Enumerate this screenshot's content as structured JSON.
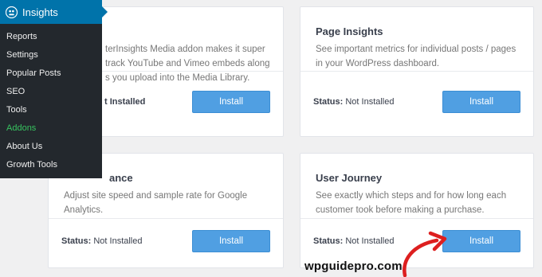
{
  "menu": {
    "title": "Insights",
    "items": [
      {
        "label": "Reports",
        "active": false
      },
      {
        "label": "Settings",
        "active": false
      },
      {
        "label": "Popular Posts",
        "active": false
      },
      {
        "label": "SEO",
        "active": false
      },
      {
        "label": "Tools",
        "active": false
      },
      {
        "label": "Addons",
        "active": true
      },
      {
        "label": "About Us",
        "active": false
      },
      {
        "label": "Growth Tools",
        "active": false
      }
    ]
  },
  "cards": [
    {
      "title": "",
      "description": "terInsights Media addon makes it super track YouTube and Vimeo embeds along s you upload into the Media Library.",
      "desc_lines": [
        "terInsights Media addon makes it super",
        "track YouTube and Vimeo embeds along",
        "s you upload into the Media Library."
      ],
      "status_prefix": "",
      "status_value": "t Installed",
      "button": "Install"
    },
    {
      "title": "Page Insights",
      "description": "See important metrics for individual posts / pages in your WordPress dashboard.",
      "desc_lines": [
        "See important metrics for individual posts / pages",
        "in your WordPress dashboard."
      ],
      "status_prefix": "Status:",
      "status_value": "Not Installed",
      "button": "Install"
    },
    {
      "title": "ance",
      "description": "Adjust site speed and sample rate for Google Analytics.",
      "desc_lines": [
        "Adjust site speed and sample rate for Google",
        "Analytics."
      ],
      "status_prefix": "Status:",
      "status_value": "Not Installed",
      "button": "Install"
    },
    {
      "title": "User Journey",
      "description": "See exactly which steps and for how long each customer took before making a purchase.",
      "desc_lines": [
        "See exactly which steps and for how long each",
        "customer took before making a purchase."
      ],
      "status_prefix": "Status:",
      "status_value": "Not Installed",
      "button": "Install"
    }
  ],
  "watermark": "wpguidepro.com",
  "colors": {
    "menu_bg": "#23282d",
    "menu_header": "#0073aa",
    "active_item": "#37c25f",
    "button": "#509fe2",
    "annotation_arrow": "#dd1f1f"
  },
  "icons": {
    "logo": "monsterinsights-logo-icon",
    "annotation": "curved-arrow-pointer"
  }
}
